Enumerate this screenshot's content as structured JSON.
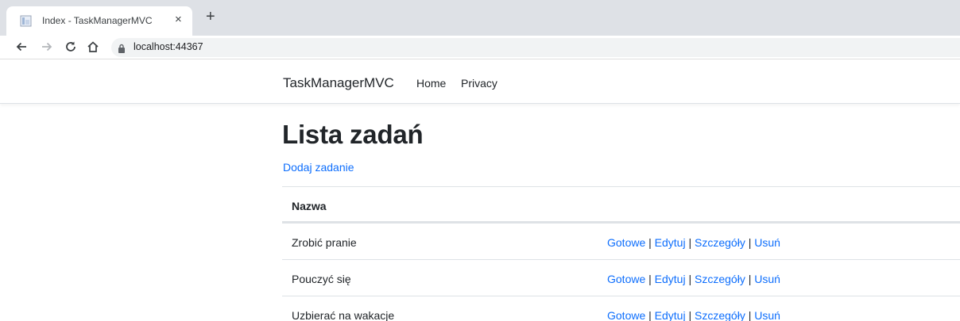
{
  "browser": {
    "tab_title": "Index - TaskManagerMVC",
    "close_glyph": "×",
    "new_tab_glyph": "+",
    "url": "localhost:44367"
  },
  "navbar": {
    "brand": "TaskManagerMVC",
    "links": [
      "Home",
      "Privacy"
    ]
  },
  "main": {
    "title": "Lista zadań",
    "add_link": "Dodaj zadanie",
    "table": {
      "header": "Nazwa",
      "rows": [
        {
          "name": "Zrobić pranie"
        },
        {
          "name": "Pouczyć się"
        },
        {
          "name": "Uzbierać na wakacje"
        }
      ],
      "actions": {
        "done": "Gotowe",
        "edit": "Edytuj",
        "details": "Szczegóły",
        "delete": "Usuń",
        "separator": "|"
      }
    }
  },
  "colors": {
    "link": "#0d6efd",
    "text": "#212529",
    "tabstrip": "#dee1e6",
    "address_bar": "#f1f3f4"
  }
}
